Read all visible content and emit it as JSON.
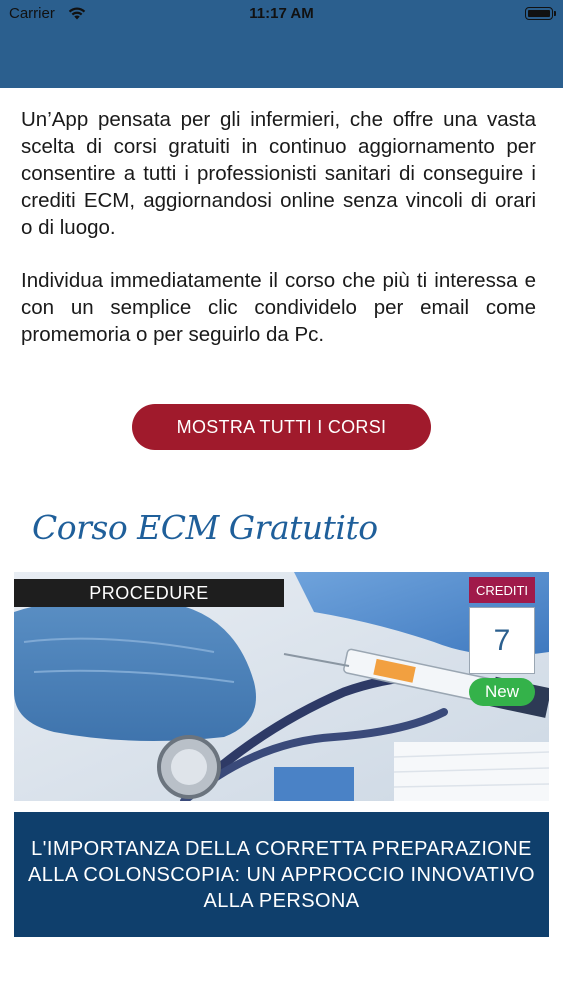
{
  "status_bar": {
    "carrier": "Carrier",
    "time": "11:17 AM",
    "wifi_icon": "wifi-icon",
    "battery_icon": "battery-icon"
  },
  "header": {
    "color": "#2b5f8e"
  },
  "intro": {
    "paragraph1": "Un’App pensata per gli infermieri, che offre una vasta scelta di corsi gratuiti in continuo aggiornamento per consentire a tutti i professionisti sanitari di conseguire i crediti ECM, aggiornandosi online senza vincoli di orari o di luogo.",
    "paragraph2": "Individua immediatamente il corso che più ti interessa e con un semplice clic condividelo per email come promemoria o per seguirlo da Pc."
  },
  "show_all_button": {
    "label": "MOSTRA TUTTI  I CORSI",
    "color": "#a01a2c"
  },
  "section": {
    "title": "Corso ECM Gratutito"
  },
  "course": {
    "category": "PROCEDURE",
    "credits_label": "CREDITI",
    "credits_value": "7",
    "badge": "New",
    "title": "L'IMPORTANZA DELLA CORRETTA PREPARAZIONE ALLA COLONSCOPIA: UN APPROCCIO INNOVATIVO ALLA PERSONA",
    "image_icon": "medical-equipment-image",
    "title_bg": "#0f3f6c",
    "badge_color": "#34b24a"
  }
}
